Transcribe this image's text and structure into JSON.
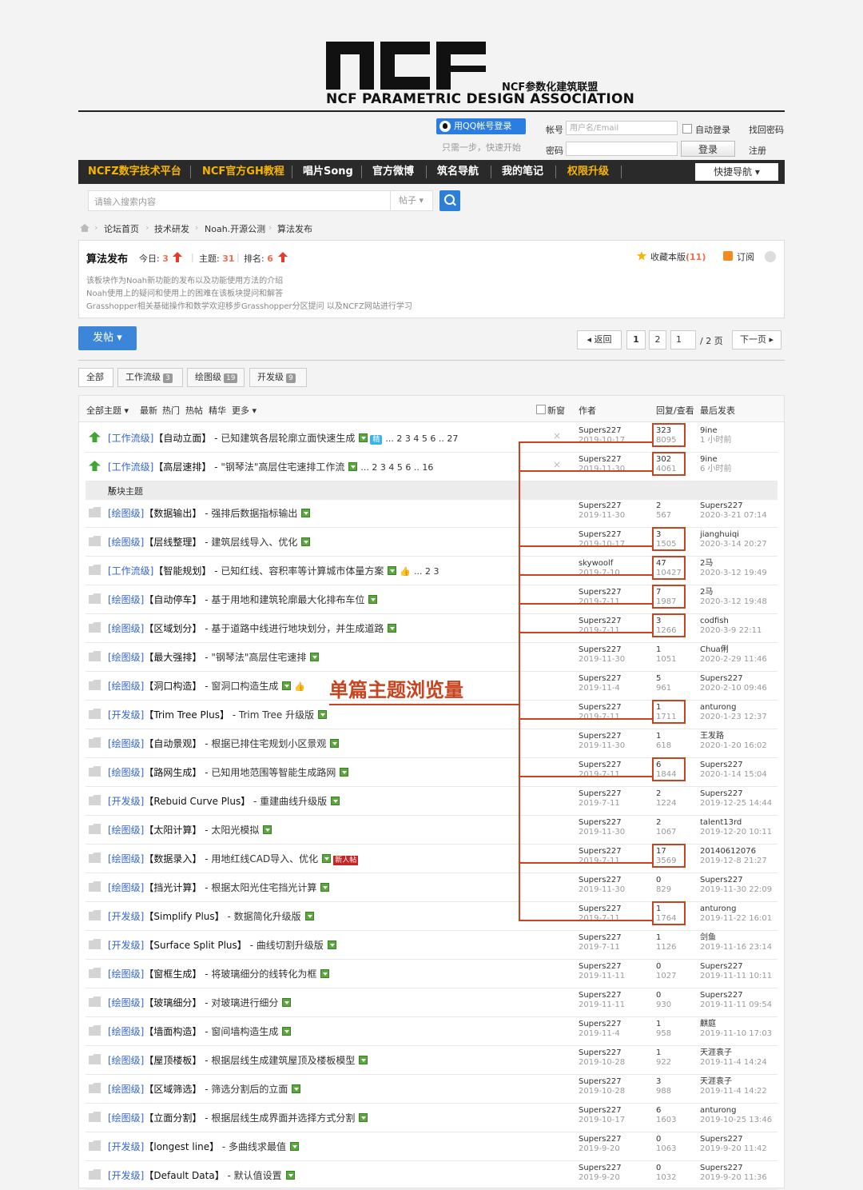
{
  "logo": {
    "mark": "ncf",
    "subtitle": "NCF参数化建筑联盟",
    "title": "NCF PARAMETRIC DESIGN ASSOCIATION"
  },
  "login": {
    "qq_button": "用QQ帐号登录",
    "qq_tip": "只需一步，快速开始",
    "account_label": "帐号",
    "account_placeholder": "用户名/Email",
    "password_label": "密码",
    "auto_login": "自动登录",
    "forgot": "找回密码",
    "login_button": "登录",
    "register": "注册"
  },
  "nav": {
    "items": [
      "NCFZ数字技术平台",
      "NCF官方GH教程",
      "唱片Song",
      "官方微博",
      "筑名导航",
      "我的笔记",
      "权限升级"
    ],
    "highlight_color": "#f7b500",
    "quick_nav": "快捷导航 ▾"
  },
  "search": {
    "placeholder": "请输入搜索内容",
    "type": "帖子 ▾"
  },
  "breadcrumb": [
    "论坛首页",
    "技术研发",
    "Noah.开源公测",
    "算法发布"
  ],
  "forum": {
    "title": "算法发布",
    "today_label": "今日:",
    "today": "3",
    "threads_label": "主题:",
    "threads": "31",
    "rank_label": "排名:",
    "rank": "6",
    "favorite": "收藏本版",
    "favorite_count": "(11)",
    "subscribe": "订阅",
    "desc": [
      "该板块作为Noah新功能的发布以及功能使用方法的介绍",
      "Noah使用上的疑问和使用上的困难在该板块提问和解答",
      "Grasshopper相关基础操作和数学欢迎移步Grasshopper分区提问 以及NCFZ网站进行学习"
    ]
  },
  "actions": {
    "post": "发帖 ▾",
    "back": "◂ 返回",
    "page1": "1",
    "page2": "2",
    "page_input": "1",
    "page_total": "/ 2 页",
    "next": "下一页 ▸"
  },
  "tabs": [
    {
      "label": "全部",
      "count": ""
    },
    {
      "label": "工作流级",
      "count": "3"
    },
    {
      "label": "绘图级",
      "count": "19"
    },
    {
      "label": "开发级",
      "count": "9"
    }
  ],
  "table_header": {
    "all": "全部主题 ▾",
    "latest": "最新",
    "hot": "热门",
    "hot_posts": "热帖",
    "digest": "精华",
    "more": "更多 ▾",
    "new_window": "新窗",
    "author": "作者",
    "replies_views": "回复/查看",
    "last_post": "最后发表"
  },
  "section_label": "版块主题",
  "sticky": [
    {
      "cat": "[工作流级]",
      "tag": "【自动立面】",
      "title": " - 已知建筑各层轮廓立面快速生成",
      "jing": "精",
      "pages": "... 2  3  4  5  6 .. 27",
      "author": "Supers227",
      "date": "2019-10-17",
      "replies": "323",
      "views": "8095",
      "last_user": "9ine",
      "last_time": "1 小时前"
    },
    {
      "cat": "[工作流级]",
      "tag": "【高层速排】",
      "title": " - \"钢琴法\"高层住宅速排工作流",
      "jing": "",
      "pages": "... 2  3  4  5  6 .. 16",
      "author": "Supers227",
      "date": "2019-11-30",
      "replies": "302",
      "views": "4061",
      "last_user": "9ine",
      "last_time": "6 小时前"
    }
  ],
  "threads": [
    {
      "cat": "[绘图级]",
      "tag": "【数据输出】",
      "title": " - 强排后数据指标输出",
      "author": "Supers227",
      "date": "2019-11-30",
      "replies": "2",
      "views": "567",
      "last_user": "Supers227",
      "last_time": "2020-3-21 07:14"
    },
    {
      "cat": "[绘图级]",
      "tag": "【层线整理】",
      "title": " - 建筑层线导入、优化",
      "author": "Supers227",
      "date": "2019-10-17",
      "replies": "3",
      "views": "1505",
      "last_user": "jianghuiqi",
      "last_time": "2020-3-14 20:27"
    },
    {
      "cat": "[工作流级]",
      "tag": "【智能规划】",
      "title": " - 已知红线、容积率等计算城市体量方案",
      "extra": "thumb",
      "pages": "... 2  3",
      "author": "skywoolf",
      "date": "2019-7-10",
      "replies": "47",
      "views": "10427",
      "last_user": "2马",
      "last_time": "2020-3-12 19:49"
    },
    {
      "cat": "[绘图级]",
      "tag": "【自动停车】",
      "title": " - 基于用地和建筑轮廓最大化排布车位",
      "author": "Supers227",
      "date": "2019-7-11",
      "replies": "7",
      "views": "1987",
      "last_user": "2马",
      "last_time": "2020-3-12 19:48"
    },
    {
      "cat": "[绘图级]",
      "tag": "【区域划分】",
      "title": " - 基于道路中线进行地块划分，并生成道路",
      "author": "Supers227",
      "date": "2019-7-11",
      "replies": "3",
      "views": "1266",
      "last_user": "codfish",
      "last_time": "2020-3-9 22:11"
    },
    {
      "cat": "[绘图级]",
      "tag": "【最大强排】",
      "title": " - \"钢琴法\"高层住宅速排",
      "author": "Supers227",
      "date": "2019-11-30",
      "replies": "1",
      "views": "1051",
      "last_user": "Chua俐",
      "last_time": "2020-2-29 11:46"
    },
    {
      "cat": "[绘图级]",
      "tag": "【洞口构造】",
      "title": " - 窗洞口构造生成",
      "extra": "thumb",
      "author": "Supers227",
      "date": "2019-11-4",
      "replies": "5",
      "views": "961",
      "last_user": "Supers227",
      "last_time": "2020-2-10 09:46"
    },
    {
      "cat": "[开发级]",
      "tag": "【Trim Tree Plus】",
      "title": " - Trim Tree 升级版",
      "author": "Supers227",
      "date": "2019-7-11",
      "replies": "1",
      "views": "1711",
      "last_user": "anturong",
      "last_time": "2020-1-23 12:37"
    },
    {
      "cat": "[绘图级]",
      "tag": "【自动景观】",
      "title": " - 根据已排住宅规划小区景观",
      "author": "Supers227",
      "date": "2019-11-30",
      "replies": "1",
      "views": "618",
      "last_user": "王发路",
      "last_time": "2020-1-20 16:02"
    },
    {
      "cat": "[绘图级]",
      "tag": "【路网生成】",
      "title": " - 已知用地范围等智能生成路网",
      "author": "Supers227",
      "date": "2019-7-11",
      "replies": "6",
      "views": "1844",
      "last_user": "Supers227",
      "last_time": "2020-1-14 15:04"
    },
    {
      "cat": "[开发级]",
      "tag": "【Rebuid Curve Plus】",
      "title": " - 重建曲线升级版",
      "author": "Supers227",
      "date": "2019-7-11",
      "replies": "2",
      "views": "1224",
      "last_user": "Supers227",
      "last_time": "2019-12-25 14:44"
    },
    {
      "cat": "[绘图级]",
      "tag": "【太阳计算】",
      "title": " - 太阳光模拟",
      "author": "Supers227",
      "date": "2019-11-30",
      "replies": "2",
      "views": "1067",
      "last_user": "talent13rd",
      "last_time": "2019-12-20 10:11"
    },
    {
      "cat": "[绘图级]",
      "tag": "【数据录入】",
      "title": " - 用地红线CAD导入、优化",
      "extra": "new",
      "author": "Supers227",
      "date": "2019-7-11",
      "replies": "17",
      "views": "3569",
      "last_user": "20140612076",
      "last_time": "2019-12-8 21:27"
    },
    {
      "cat": "[绘图级]",
      "tag": "【挡光计算】",
      "title": " - 根据太阳光住宅挡光计算",
      "author": "Supers227",
      "date": "2019-11-30",
      "replies": "0",
      "views": "829",
      "last_user": "Supers227",
      "last_time": "2019-11-30 22:09"
    },
    {
      "cat": "[开发级]",
      "tag": "【Simplify Plus】",
      "title": " - 数据简化升级版",
      "author": "Supers227",
      "date": "2019-7-11",
      "replies": "1",
      "views": "1764",
      "last_user": "anturong",
      "last_time": "2019-11-22 16:01"
    },
    {
      "cat": "[开发级]",
      "tag": "【Surface Split Plus】",
      "title": " - 曲线切割升级版",
      "author": "Supers227",
      "date": "2019-7-11",
      "replies": "1",
      "views": "1126",
      "last_user": "剑鱼",
      "last_time": "2019-11-16 23:14"
    },
    {
      "cat": "[绘图级]",
      "tag": "【窗框生成】",
      "title": " - 将玻璃细分的线转化为框",
      "author": "Supers227",
      "date": "2019-11-11",
      "replies": "0",
      "views": "1027",
      "last_user": "Supers227",
      "last_time": "2019-11-11 10:11"
    },
    {
      "cat": "[绘图级]",
      "tag": "【玻璃细分】",
      "title": " - 对玻璃进行细分",
      "author": "Supers227",
      "date": "2019-11-11",
      "replies": "0",
      "views": "930",
      "last_user": "Supers227",
      "last_time": "2019-11-11 09:54"
    },
    {
      "cat": "[绘图级]",
      "tag": "【墙面构造】",
      "title": " - 窗间墙构造生成",
      "author": "Supers227",
      "date": "2019-11-4",
      "replies": "1",
      "views": "958",
      "last_user": "麒庭",
      "last_time": "2019-11-10 17:03"
    },
    {
      "cat": "[绘图级]",
      "tag": "【屋顶楼板】",
      "title": " - 根据层线生成建筑屋顶及楼板模型",
      "author": "Supers227",
      "date": "2019-10-28",
      "replies": "1",
      "views": "922",
      "last_user": "天涯袁子",
      "last_time": "2019-11-4 14:24"
    },
    {
      "cat": "[绘图级]",
      "tag": "【区域筛选】",
      "title": " - 筛选分割后的立面",
      "author": "Supers227",
      "date": "2019-10-28",
      "replies": "3",
      "views": "988",
      "last_user": "天涯袁子",
      "last_time": "2019-11-4 14:22"
    },
    {
      "cat": "[绘图级]",
      "tag": "【立面分割】",
      "title": " - 根据层线生成界面并选择方式分割",
      "author": "Supers227",
      "date": "2019-10-17",
      "replies": "6",
      "views": "1603",
      "last_user": "anturong",
      "last_time": "2019-10-25 13:46"
    },
    {
      "cat": "[开发级]",
      "tag": "【longest line】",
      "title": " - 多曲线求最值",
      "author": "Supers227",
      "date": "2019-9-20",
      "replies": "0",
      "views": "1063",
      "last_user": "Supers227",
      "last_time": "2019-9-20 11:42"
    },
    {
      "cat": "[开发级]",
      "tag": "【Default Data】",
      "title": " - 默认值设置",
      "author": "Supers227",
      "date": "2019-9-20",
      "replies": "0",
      "views": "1032",
      "last_user": "Supers227",
      "last_time": "2019-9-20 11:36"
    }
  ],
  "annotation": {
    "text": "单篇主题浏览量",
    "color": "#c8431e"
  }
}
